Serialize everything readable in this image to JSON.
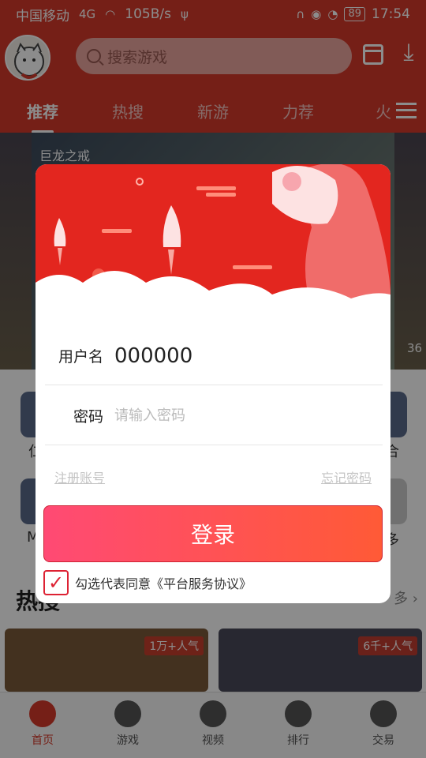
{
  "status_bar": {
    "carrier": "中国移动",
    "network": "4G",
    "speed": "105B/s",
    "battery": "89",
    "time": "17:54"
  },
  "header": {
    "search_placeholder": "搜索游戏",
    "tabs": [
      {
        "label": "推荐",
        "active": true
      },
      {
        "label": "热搜",
        "active": false
      },
      {
        "label": "新游",
        "active": false
      },
      {
        "label": "力荐",
        "active": false
      },
      {
        "label": "火",
        "active": false
      }
    ]
  },
  "banner": {
    "title": "巨龙之戒",
    "side_count": "36"
  },
  "sections": {
    "hot_title": "热搜",
    "more_label": "多",
    "side_left_1": "仁",
    "side_right_1": "合",
    "side_left_2": "M",
    "side_right_2": "多",
    "cards": [
      {
        "popularity": "1万+人气"
      },
      {
        "popularity": "6千+人气"
      }
    ]
  },
  "bottom_nav": [
    {
      "label": "首页",
      "active": true
    },
    {
      "label": "游戏",
      "active": false
    },
    {
      "label": "视频",
      "active": false
    },
    {
      "label": "排行",
      "active": false
    },
    {
      "label": "交易",
      "active": false
    }
  ],
  "login_dialog": {
    "username_label": "用户名",
    "username_value": "000000",
    "password_label": "密码",
    "password_placeholder": "请输入密码",
    "register_link": "注册账号",
    "forgot_link": "忘记密码",
    "login_button": "登录",
    "agree_checked": true,
    "agree_text": "勾选代表同意《平台服务协议》"
  },
  "colors": {
    "brand_red": "#d63a2a",
    "button_gradient_start": "#ff4a74",
    "button_gradient_end": "#ff5a36"
  }
}
